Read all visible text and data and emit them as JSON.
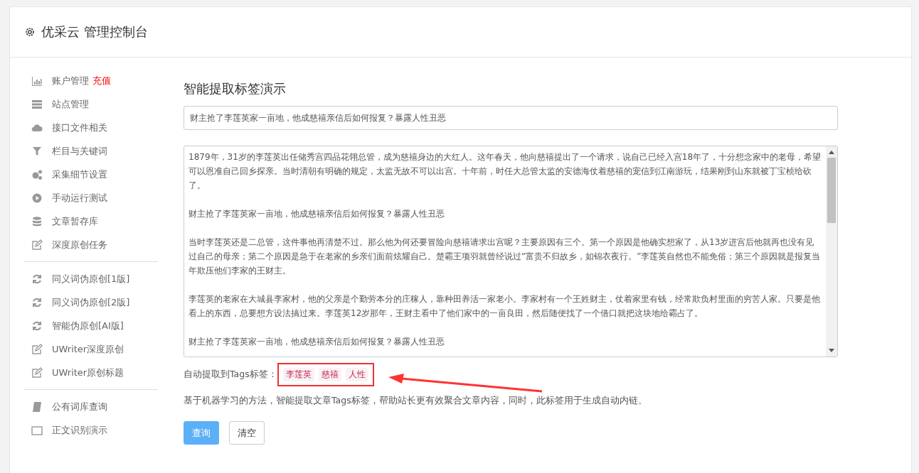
{
  "header": {
    "title": "优采云 管理控制台"
  },
  "sidebar": {
    "groups": [
      {
        "items": [
          {
            "label": "账户管理",
            "badge": "充值"
          },
          {
            "label": "站点管理"
          },
          {
            "label": "接口文件相关"
          },
          {
            "label": "栏目与关键词"
          },
          {
            "label": "采集细节设置"
          },
          {
            "label": "手动运行测试"
          },
          {
            "label": "文章暂存库"
          },
          {
            "label": "深度原创任务"
          }
        ]
      },
      {
        "items": [
          {
            "label": "同义词伪原创[1版]"
          },
          {
            "label": "同义词伪原创[2版]"
          },
          {
            "label": "智能伪原创[AI版]"
          },
          {
            "label": "UWriter深度原创"
          },
          {
            "label": "UWriter原创标题"
          }
        ]
      },
      {
        "items": [
          {
            "label": "公有词库查询"
          },
          {
            "label": "正文识别演示"
          }
        ]
      }
    ]
  },
  "main": {
    "heading": "智能提取标签演示",
    "title_field": {
      "value": "财主抢了李莲英家一亩地，他成慈禧亲信后如何报复？暴露人性丑恶"
    },
    "content_paragraphs": [
      "1879年，31岁的李莲英出任储秀宫四品花翎总管，成为慈禧身边的大红人。这年春天，他向慈禧提出了一个请求，说自己已经入宫18年了，十分想念家中的老母，希望可以恩准自己回乡探亲。当时清朝有明确的规定，太监无故不可以出宫。十年前，时任大总管太监的安德海仗着慈禧的宠信到江南游玩，结果刚到山东就被丁宝桢给砍了。",
      "财主抢了李莲英家一亩地，他成慈禧亲信后如何报复？暴露人性丑恶",
      "当时李莲英还是二总管，这件事他再清楚不过。那么他为何还要冒险向慈禧请求出宫呢？主要原因有三个。第一个原因是他确实想家了，从13岁进宫后他就再也没有见过自己的母亲；第二个原因是急于在老家的乡亲们面前炫耀自己。楚霸王项羽就曾经说过“富贵不归故乡，如锦衣夜行。”李莲英自然也不能免俗；第三个原因就是报复当年欺压他们李家的王财主。",
      "李莲英的老家在大城县李家村，他的父亲是个勤劳本分的庄稼人，靠种田养活一家老小。李家村有一个王姓财主，仗着家里有钱，经常欺负村里面的穷苦人家。只要是他看上的东西，总要想方设法搞过来。李莲英12岁那年，王财主看中了他们家中的一亩良田，然后随便找了一个借口就把这块地给霸占了。",
      "财主抢了李莲英家一亩地，他成慈禧亲信后如何报复？暴露人性丑恶"
    ],
    "tags_label": "自动提取到Tags标签：",
    "tags": [
      "李莲英",
      "慈禧",
      "人性"
    ],
    "description": "基于机器学习的方法，智能提取文章Tags标签，帮助站长更有效聚合文章内容，同时，此标签用于生成自动内链。",
    "buttons": [
      {
        "kind": "primary",
        "label": "查询"
      },
      {
        "kind": "default",
        "label": "清空"
      }
    ]
  }
}
